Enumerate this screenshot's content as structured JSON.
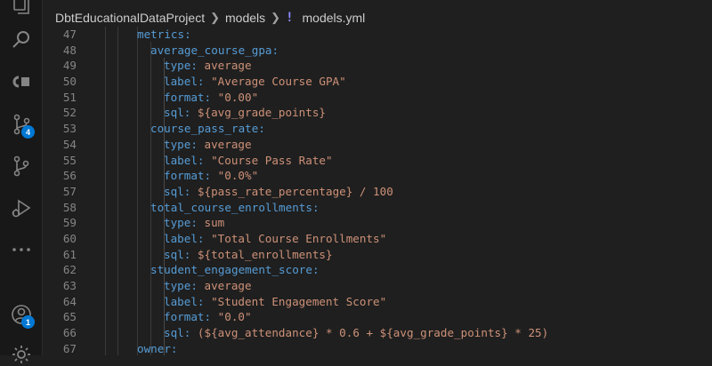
{
  "breadcrumb": {
    "project": "DbtEducationalDataProject",
    "folder": "models",
    "file_icon": "!",
    "file": "models.yml"
  },
  "activity_bar": {
    "items": [
      {
        "name": "explorer-icon"
      },
      {
        "name": "search-icon"
      },
      {
        "name": "copilot-icon"
      },
      {
        "name": "source-control-icon",
        "badge": "4"
      },
      {
        "name": "git-graph-icon"
      },
      {
        "name": "run-debug-icon"
      },
      {
        "name": "more-icon"
      },
      {
        "name": "accounts-icon",
        "badge": "1"
      },
      {
        "name": "settings-gear-icon"
      }
    ]
  },
  "code_lines": [
    {
      "num": "47",
      "indent": 0,
      "key": "metrics:",
      "val": ""
    },
    {
      "num": "48",
      "indent": 1,
      "key": "average_course_gpa:",
      "val": ""
    },
    {
      "num": "49",
      "indent": 2,
      "key": "type:",
      "val": " average"
    },
    {
      "num": "50",
      "indent": 2,
      "key": "label:",
      "val": " \"Average Course GPA\""
    },
    {
      "num": "51",
      "indent": 2,
      "key": "format:",
      "val": " \"0.00\""
    },
    {
      "num": "52",
      "indent": 2,
      "key": "sql:",
      "val": " ${avg_grade_points}"
    },
    {
      "num": "53",
      "indent": 1,
      "key": "course_pass_rate:",
      "val": ""
    },
    {
      "num": "54",
      "indent": 2,
      "key": "type:",
      "val": " average"
    },
    {
      "num": "55",
      "indent": 2,
      "key": "label:",
      "val": " \"Course Pass Rate\""
    },
    {
      "num": "56",
      "indent": 2,
      "key": "format:",
      "val": " \"0.0%\""
    },
    {
      "num": "57",
      "indent": 2,
      "key": "sql:",
      "val": " ${pass_rate_percentage} / 100"
    },
    {
      "num": "58",
      "indent": 1,
      "key": "total_course_enrollments:",
      "val": ""
    },
    {
      "num": "59",
      "indent": 2,
      "key": "type:",
      "val": " sum"
    },
    {
      "num": "60",
      "indent": 2,
      "key": "label:",
      "val": " \"Total Course Enrollments\""
    },
    {
      "num": "61",
      "indent": 2,
      "key": "sql:",
      "val": " ${total_enrollments}"
    },
    {
      "num": "62",
      "indent": 1,
      "key": "student_engagement_score:",
      "val": ""
    },
    {
      "num": "63",
      "indent": 2,
      "key": "type:",
      "val": " average"
    },
    {
      "num": "64",
      "indent": 2,
      "key": "label:",
      "val": " \"Student Engagement Score\""
    },
    {
      "num": "65",
      "indent": 2,
      "key": "format:",
      "val": " \"0.0\""
    },
    {
      "num": "66",
      "indent": 2,
      "key": "sql:",
      "val": " (${avg_attendance} * 0.6 + ${avg_grade_points} * 25)"
    },
    {
      "num": "67",
      "indent": 0,
      "key": "owner:",
      "val": ""
    }
  ],
  "colors": {
    "key": "#569cd6",
    "value": "#ce9178",
    "line_number": "#858585",
    "badge": "#0078d4"
  }
}
